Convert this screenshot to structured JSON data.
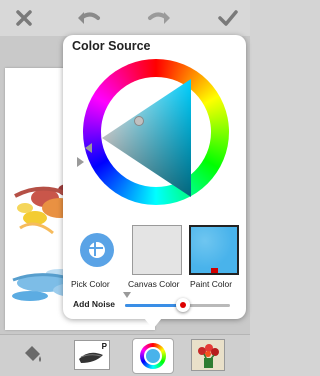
{
  "topbar": {
    "icons": [
      "close-icon",
      "undo-icon",
      "redo-icon",
      "checkmark-icon"
    ]
  },
  "popup": {
    "title": "Color Source",
    "swatches": [
      {
        "label": "Pick Color",
        "icon": "eyedropper-target-icon"
      },
      {
        "label": "Canvas Color",
        "color": "#e4e4e4"
      },
      {
        "label": "Paint Color",
        "color": "#49b3eb"
      }
    ],
    "noise": {
      "label": "Add Noise",
      "value": 0.55
    }
  },
  "bottombar": {
    "brush_badge": "P",
    "icons": [
      "paint-bucket-icon",
      "brush-icon",
      "color-wheel-icon",
      "flower-image-icon"
    ]
  },
  "colors": {
    "accent": "#3a8ee6",
    "paint": "#49b3eb",
    "marker": "#dd0000"
  }
}
